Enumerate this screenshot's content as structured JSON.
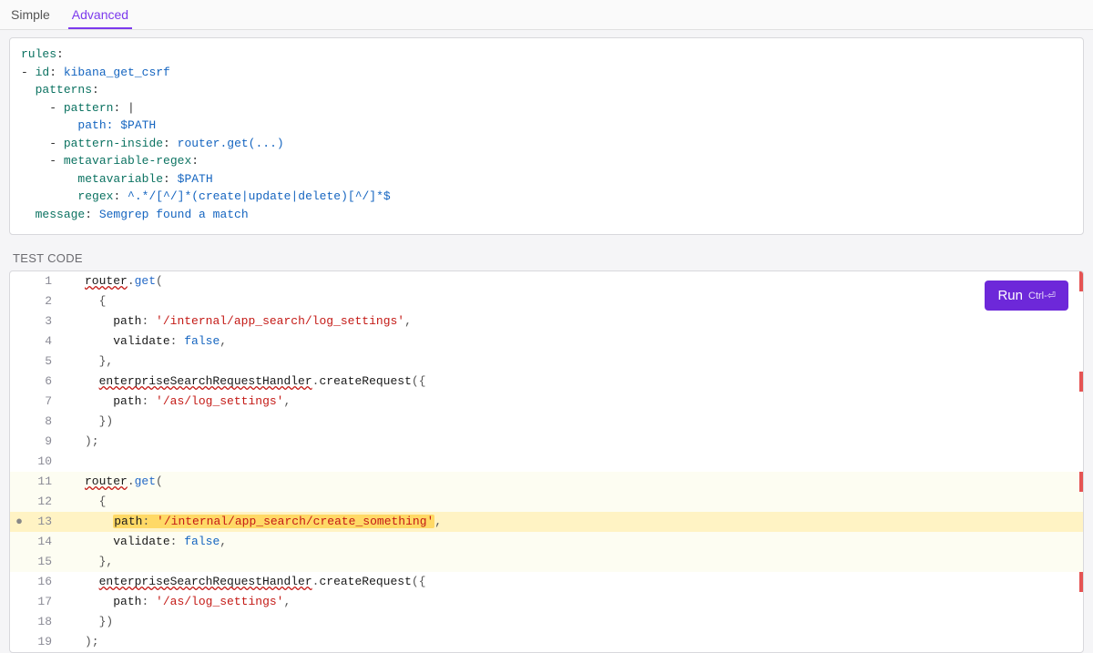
{
  "tabs": {
    "simple": "Simple",
    "advanced": "Advanced"
  },
  "yaml": {
    "l1": {
      "k": "rules",
      "c": ":"
    },
    "l2": {
      "dash": "- ",
      "k": "id",
      "c": ": ",
      "v": "kibana_get_csrf"
    },
    "l3": {
      "k": "patterns",
      "c": ":"
    },
    "l4": {
      "dash": "- ",
      "k": "pattern",
      "c": ": ",
      "pipe": "|"
    },
    "l5": {
      "v": "path: $PATH"
    },
    "l6": {
      "dash": "- ",
      "k": "pattern-inside",
      "c": ": ",
      "v": "router.get(...)"
    },
    "l7": {
      "dash": "- ",
      "k": "metavariable-regex",
      "c": ":"
    },
    "l8": {
      "k": "metavariable",
      "c": ": ",
      "v": "$PATH"
    },
    "l9": {
      "k": "regex",
      "c": ": ",
      "v": "^.*/[^/]*(create|update|delete)[^/]*$"
    },
    "l10": {
      "k": "message",
      "c": ": ",
      "v": "Semgrep found a match"
    }
  },
  "section_label": "TEST CODE",
  "run": {
    "label": "Run",
    "hint": "Ctrl-⏎"
  },
  "code": {
    "l1": {
      "n": "1",
      "pre": "",
      "router": "router",
      "dot": ".",
      "get": "get",
      "tail": "("
    },
    "l2": {
      "n": "2",
      "txt": "  {"
    },
    "l3": {
      "n": "3",
      "pre": "    ",
      "k": "path",
      "c": ": ",
      "s": "'/internal/app_search/log_settings'",
      "t": ","
    },
    "l4": {
      "n": "4",
      "pre": "    ",
      "k": "validate",
      "c": ": ",
      "kw": "false",
      "t": ","
    },
    "l5": {
      "n": "5",
      "txt": "  },"
    },
    "l6": {
      "n": "6",
      "pre": "  ",
      "id": "enterpriseSearchRequestHandler",
      "dot": ".",
      "m": "createRequest",
      "tail": "({"
    },
    "l7": {
      "n": "7",
      "pre": "    ",
      "k": "path",
      "c": ": ",
      "s": "'/as/log_settings'",
      "t": ","
    },
    "l8": {
      "n": "8",
      "txt": "  })"
    },
    "l9": {
      "n": "9",
      "txt": ");"
    },
    "l10": {
      "n": "10",
      "txt": ""
    },
    "l11": {
      "n": "11",
      "pre": "",
      "router": "router",
      "dot": ".",
      "get": "get",
      "tail": "("
    },
    "l12": {
      "n": "12",
      "txt": "  {"
    },
    "l13": {
      "n": "13",
      "pre": "    ",
      "k": "path",
      "c": ": ",
      "s": "'/internal/app_search/create_something'",
      "t": ","
    },
    "l14": {
      "n": "14",
      "pre": "    ",
      "k": "validate",
      "c": ": ",
      "kw": "false",
      "t": ","
    },
    "l15": {
      "n": "15",
      "txt": "  },"
    },
    "l16": {
      "n": "16",
      "pre": "  ",
      "id": "enterpriseSearchRequestHandler",
      "dot": ".",
      "m": "createRequest",
      "tail": "({"
    },
    "l17": {
      "n": "17",
      "pre": "    ",
      "k": "path",
      "c": ": ",
      "s": "'/as/log_settings'",
      "t": ","
    },
    "l18": {
      "n": "18",
      "txt": "  })"
    },
    "l19": {
      "n": "19",
      "txt": ");"
    }
  }
}
